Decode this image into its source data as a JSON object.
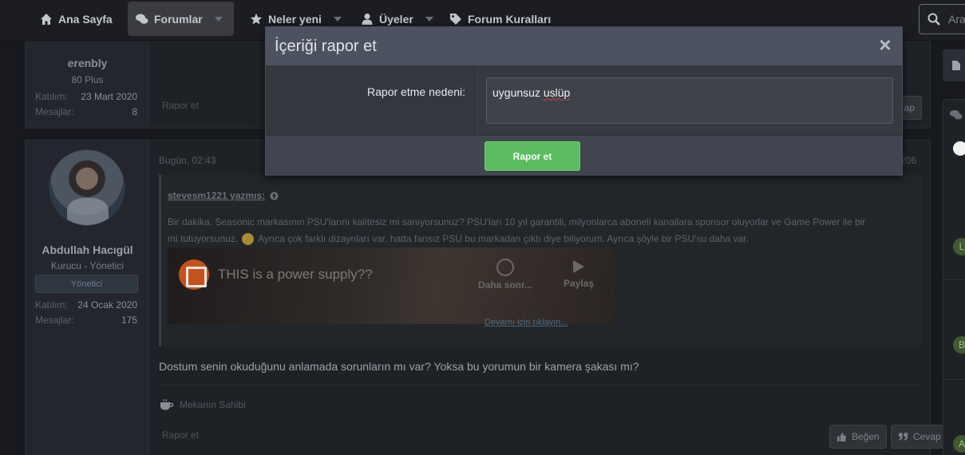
{
  "nav": {
    "items": [
      {
        "label": "Ana Sayfa",
        "icon": "home-icon"
      },
      {
        "label": "Forumlar",
        "icon": "comments-icon"
      },
      {
        "label": "Neler yeni",
        "icon": "star-icon"
      },
      {
        "label": "Üyeler",
        "icon": "user-icon"
      },
      {
        "label": "Forum Kuralları",
        "icon": "tag-icon"
      }
    ],
    "search_placeholder": "Ara"
  },
  "post1": {
    "username": "erenbly",
    "user_title": "80 Plus",
    "joined_label": "Katılım:",
    "joined_value": "23 Mart 2020",
    "messages_label": "Mesajlar:",
    "messages_value": "8",
    "report_link": "Rapor et",
    "reply_fragment": "ap"
  },
  "post2": {
    "username": "Abdullah Hacıgül",
    "user_title": "Kurucu - Yönetici",
    "badge": "Yönetici",
    "joined_label": "Katılım:",
    "joined_value": "24 Ocak 2020",
    "messages_label": "Mesajlar:",
    "messages_value": "175",
    "timestamp": "Bugün, 02:43",
    "post_number_fragment": "206",
    "quote_author": "stevesm1221 yazmış:",
    "quote_text_1": "Bir dakika. Seasonic markasının PSU'larını kalitesiz mi sanıyorsunuz? PSU'ları 10 yıl garantili, milyonlarca aboneli kanallara sponsor oluyorlar ve Game Power ile bir mi tutuyorsunuz.",
    "quote_text_2": "Ayrıca çok farklı dizaynları var, hatta fansız PSU bu markadan çıktı diye biliyorum. Ayrıca şöyle bir PSU'su daha var.",
    "video_title": "THIS is a power supply??",
    "video_watch_later": "Daha sonr...",
    "video_share": "Paylaş",
    "quote_more": "Devamı için tıklayın...",
    "message": "Dostum senin okuduğunu anlamada sorunların mı var? Yoksa bu yorumun bir kamera şakası mı?",
    "signature": "Mekanın Sahibi",
    "report_link": "Rapor et",
    "like_button": "Beğen",
    "reply_button": "Cevap"
  },
  "sidebar": {
    "avatar_letters": [
      "L",
      "B",
      "A"
    ]
  },
  "modal": {
    "title": "İçeriği rapor et",
    "close": "×",
    "reason_label": "Rapor etme nedeni:",
    "reason_value_1": "uygunsuz ",
    "reason_value_2": "uslüp",
    "submit": "Rapor et"
  },
  "colors": {
    "submit_green": "#5bbd5f",
    "modal_header": "#4d5260",
    "page_bg": "#17191e"
  }
}
